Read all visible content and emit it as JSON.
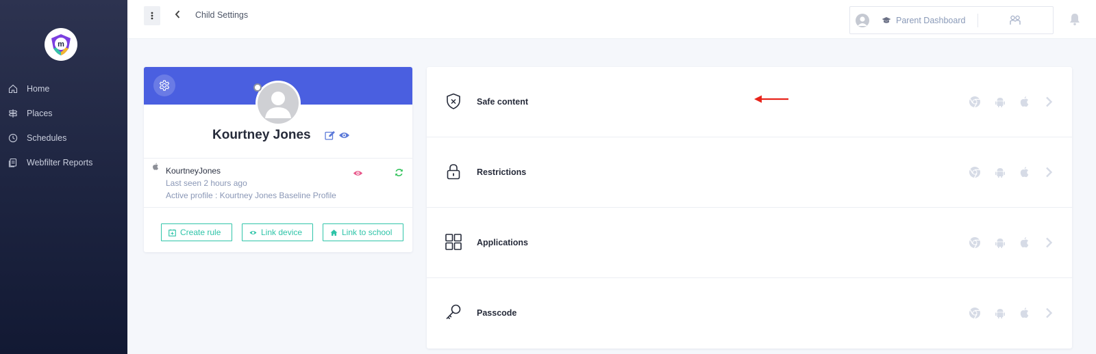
{
  "sidebar": {
    "items": [
      {
        "label": "Home",
        "icon": "home-icon"
      },
      {
        "label": "Places",
        "icon": "signpost-icon"
      },
      {
        "label": "Schedules",
        "icon": "clock-icon"
      },
      {
        "label": "Webfilter Reports",
        "icon": "report-icon"
      }
    ]
  },
  "header": {
    "breadcrumb": "Child Settings",
    "dashboard_label": "Parent Dashboard"
  },
  "profile": {
    "name": "Kourtney Jones",
    "device_name": "KourtneyJones",
    "last_seen": "Last seen 2 hours ago",
    "active_profile": "Active profile : Kourtney Jones Baseline Profile",
    "buttons": {
      "create_rule": "Create rule",
      "link_device": "Link device",
      "link_school": "Link to school"
    }
  },
  "settings": {
    "rows": [
      {
        "label": "Safe content",
        "icon": "shield-x-icon"
      },
      {
        "label": "Restrictions",
        "icon": "lock-icon"
      },
      {
        "label": "Applications",
        "icon": "grid-icon"
      },
      {
        "label": "Passcode",
        "icon": "key-icon"
      }
    ]
  },
  "colors": {
    "accent": "#4a5fe0",
    "teal": "#2ec4a8",
    "annotation_arrow": "#e8231a"
  }
}
